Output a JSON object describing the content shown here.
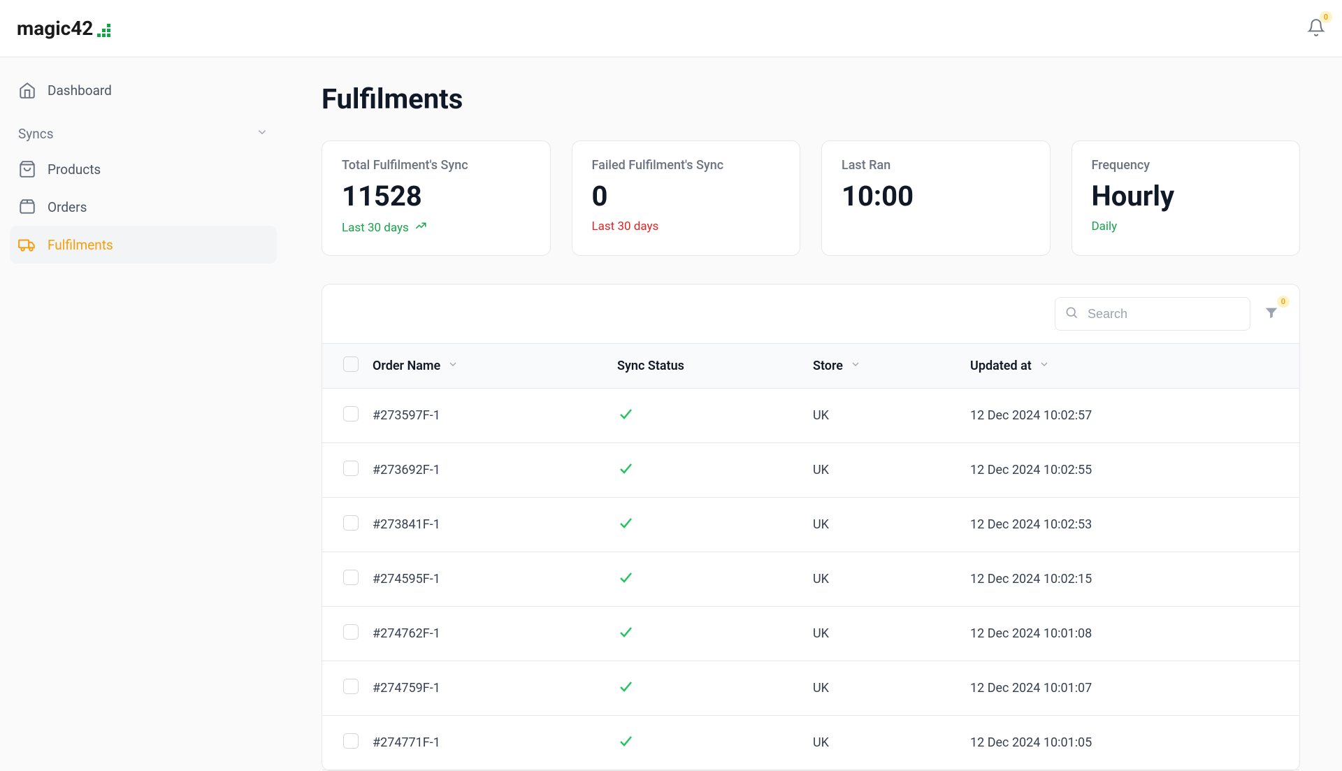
{
  "header": {
    "brand": "magic42",
    "notif_count": "0"
  },
  "sidebar": {
    "dashboard_label": "Dashboard",
    "syncs_label": "Syncs",
    "products_label": "Products",
    "orders_label": "Orders",
    "fulfilments_label": "Fulfilments"
  },
  "page": {
    "title": "Fulfilments"
  },
  "stats": {
    "total": {
      "label": "Total Fulfilment's Sync",
      "value": "11528",
      "sub": "Last 30 days"
    },
    "failed": {
      "label": "Failed Fulfilment's Sync",
      "value": "0",
      "sub": "Last 30 days"
    },
    "lastran": {
      "label": "Last Ran",
      "value": "10:00"
    },
    "frequency": {
      "label": "Frequency",
      "value": "Hourly",
      "sub": "Daily"
    }
  },
  "toolbar": {
    "search_placeholder": "Search",
    "filter_count": "0"
  },
  "table": {
    "headers": {
      "order": "Order Name",
      "status": "Sync Status",
      "store": "Store",
      "updated": "Updated at"
    },
    "rows": [
      {
        "order": "#273597F-1",
        "store": "UK",
        "updated": "12 Dec 2024 10:02:57"
      },
      {
        "order": "#273692F-1",
        "store": "UK",
        "updated": "12 Dec 2024 10:02:55"
      },
      {
        "order": "#273841F-1",
        "store": "UK",
        "updated": "12 Dec 2024 10:02:53"
      },
      {
        "order": "#274595F-1",
        "store": "UK",
        "updated": "12 Dec 2024 10:02:15"
      },
      {
        "order": "#274762F-1",
        "store": "UK",
        "updated": "12 Dec 2024 10:01:08"
      },
      {
        "order": "#274759F-1",
        "store": "UK",
        "updated": "12 Dec 2024 10:01:07"
      },
      {
        "order": "#274771F-1",
        "store": "UK",
        "updated": "12 Dec 2024 10:01:05"
      }
    ]
  }
}
